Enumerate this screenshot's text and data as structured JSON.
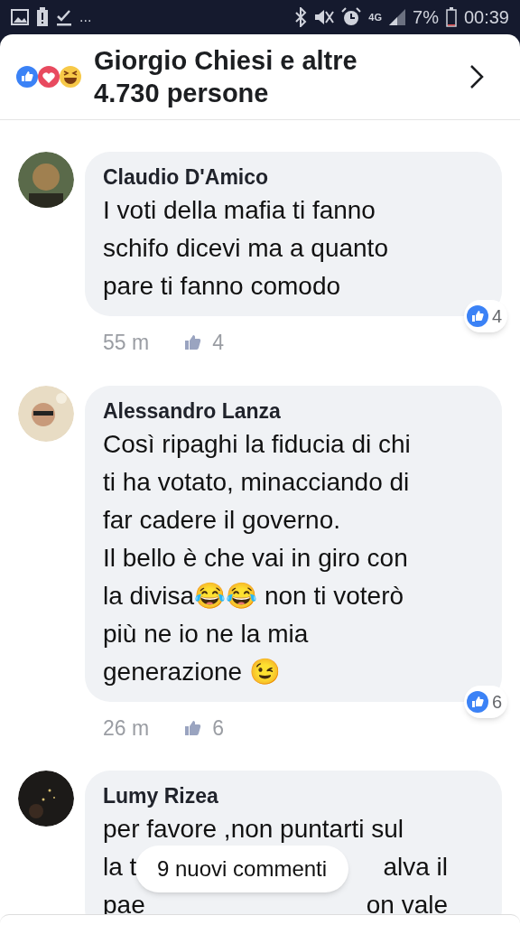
{
  "status_bar": {
    "left_more": "...",
    "network": "4G",
    "battery": "7%",
    "time": "00:39"
  },
  "header": {
    "title": "Giorgio Chiesi e altre 4.730 persone"
  },
  "comments": [
    {
      "author": "Claudio D'Amico",
      "lines": [
        "I voti della mafia ti fanno",
        "schifo dicevi ma a quanto",
        "pare ti fanno comodo"
      ],
      "time": "55 m",
      "like_count": "4",
      "reaction_count": "4"
    },
    {
      "author": "Alessandro Lanza",
      "lines": [
        "Così ripaghi la fiducia di chi",
        "ti ha votato, minacciando di",
        "far cadere il governo.",
        "Il bello è che vai in giro con",
        "la divisa😂😂 non ti voterò",
        "più ne io ne la mia",
        "generazione 😉"
      ],
      "time": "26 m",
      "like_count": "6",
      "reaction_count": "6"
    },
    {
      "author": "Lumy Rizea",
      "lines": [
        "per favore ,non puntarti sul"
      ],
      "covered_lines": [
        [
          "la t",
          "alva il"
        ],
        [
          "pae",
          "on vale"
        ]
      ]
    }
  ],
  "toast": {
    "label": "9 nuovi commenti"
  }
}
